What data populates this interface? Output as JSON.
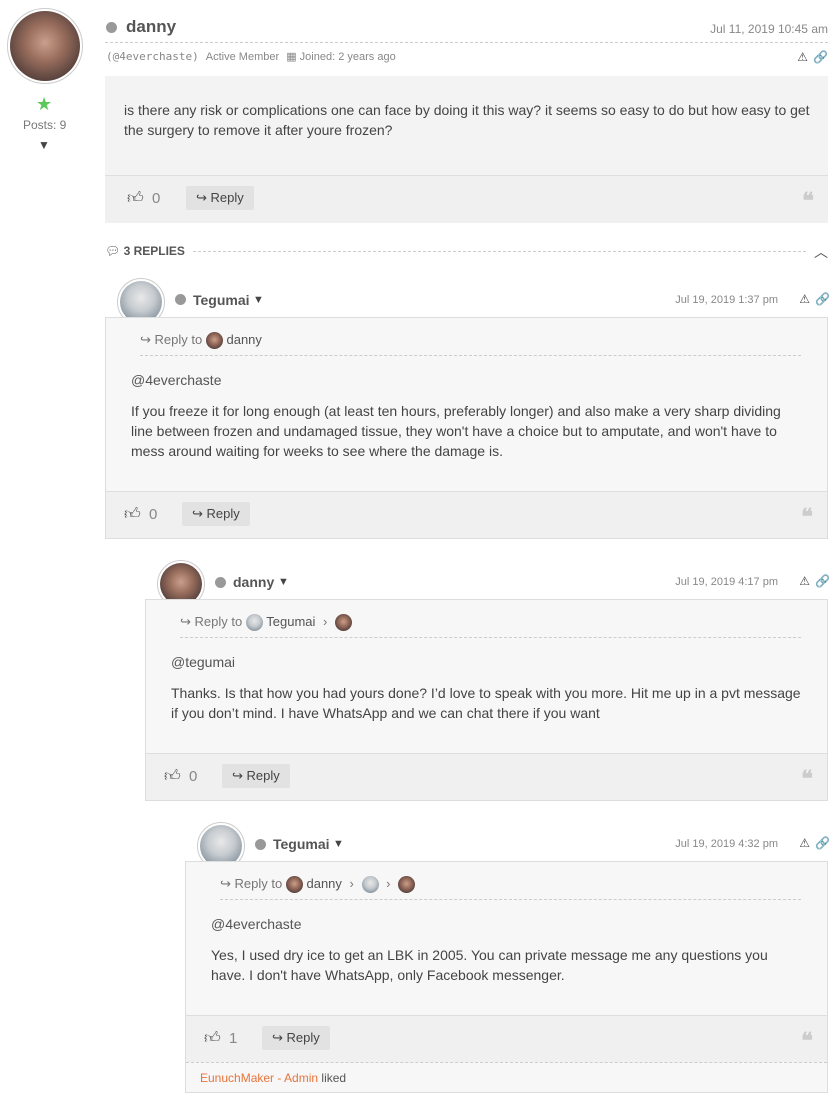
{
  "topic": {
    "author": "danny",
    "date": "Jul 11, 2019 10:45 am",
    "handle": "(@4everchaste)",
    "role": "Active Member",
    "joined": "Joined: 2 years ago",
    "posts_label": "Posts: 9",
    "body": "is there any risk or complications one can face by doing it this way?   it seems so easy to do but how easy to get the surgery to remove it after youre frozen?",
    "likes": "0",
    "reply_label": "Reply"
  },
  "replies_header": "3 REPLIES",
  "replies": [
    {
      "author": "Tegumai",
      "date": "Jul 19, 2019 1:37 pm",
      "reply_to_label": "Reply to",
      "reply_to_name": "danny",
      "mention": "@4everchaste",
      "body": "If you freeze it for long enough (at least ten hours, preferably longer) and also make a very sharp dividing line between frozen and undamaged tissue, they won't have a choice but to amputate, and won't have to mess around waiting for weeks to see where the damage is.",
      "likes": "0",
      "reply_label": "Reply"
    },
    {
      "author": "danny",
      "date": "Jul 19, 2019 4:17 pm",
      "reply_to_label": "Reply to",
      "reply_to_name": "Tegumai",
      "mention": "@tegumai",
      "body": "Thanks. Is that how you had yours done?   I’d love to speak with you more.  Hit me up in a pvt message if you don’t mind. I have WhatsApp and we can chat there if you want",
      "likes": "0",
      "reply_label": "Reply"
    },
    {
      "author": "Tegumai",
      "date": "Jul 19, 2019 4:32 pm",
      "reply_to_label": "Reply to",
      "reply_to_name": "danny",
      "mention": "@4everchaste",
      "body": "Yes, I used dry ice to get an LBK in 2005. You can private message me any questions you have. I don't have WhatsApp, only Facebook messenger.",
      "likes": "1",
      "reply_label": "Reply",
      "liked_by": "EunuchMaker - Admin",
      "liked_suffix": "liked"
    }
  ],
  "colors": {
    "accent_link": "#e8743b",
    "star": "#5cc85c"
  }
}
